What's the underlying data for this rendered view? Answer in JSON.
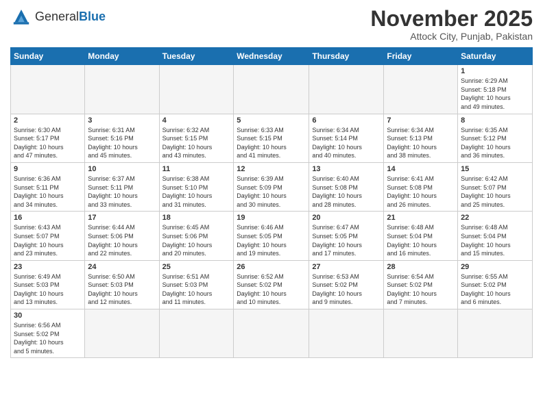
{
  "header": {
    "logo_general": "General",
    "logo_blue": "Blue",
    "month_title": "November 2025",
    "subtitle": "Attock City, Punjab, Pakistan"
  },
  "days_header": [
    "Sunday",
    "Monday",
    "Tuesday",
    "Wednesday",
    "Thursday",
    "Friday",
    "Saturday"
  ],
  "weeks": [
    [
      {
        "num": "",
        "info": ""
      },
      {
        "num": "",
        "info": ""
      },
      {
        "num": "",
        "info": ""
      },
      {
        "num": "",
        "info": ""
      },
      {
        "num": "",
        "info": ""
      },
      {
        "num": "",
        "info": ""
      },
      {
        "num": "1",
        "info": "Sunrise: 6:29 AM\nSunset: 5:18 PM\nDaylight: 10 hours\nand 49 minutes."
      }
    ],
    [
      {
        "num": "2",
        "info": "Sunrise: 6:30 AM\nSunset: 5:17 PM\nDaylight: 10 hours\nand 47 minutes."
      },
      {
        "num": "3",
        "info": "Sunrise: 6:31 AM\nSunset: 5:16 PM\nDaylight: 10 hours\nand 45 minutes."
      },
      {
        "num": "4",
        "info": "Sunrise: 6:32 AM\nSunset: 5:15 PM\nDaylight: 10 hours\nand 43 minutes."
      },
      {
        "num": "5",
        "info": "Sunrise: 6:33 AM\nSunset: 5:15 PM\nDaylight: 10 hours\nand 41 minutes."
      },
      {
        "num": "6",
        "info": "Sunrise: 6:34 AM\nSunset: 5:14 PM\nDaylight: 10 hours\nand 40 minutes."
      },
      {
        "num": "7",
        "info": "Sunrise: 6:34 AM\nSunset: 5:13 PM\nDaylight: 10 hours\nand 38 minutes."
      },
      {
        "num": "8",
        "info": "Sunrise: 6:35 AM\nSunset: 5:12 PM\nDaylight: 10 hours\nand 36 minutes."
      }
    ],
    [
      {
        "num": "9",
        "info": "Sunrise: 6:36 AM\nSunset: 5:11 PM\nDaylight: 10 hours\nand 34 minutes."
      },
      {
        "num": "10",
        "info": "Sunrise: 6:37 AM\nSunset: 5:11 PM\nDaylight: 10 hours\nand 33 minutes."
      },
      {
        "num": "11",
        "info": "Sunrise: 6:38 AM\nSunset: 5:10 PM\nDaylight: 10 hours\nand 31 minutes."
      },
      {
        "num": "12",
        "info": "Sunrise: 6:39 AM\nSunset: 5:09 PM\nDaylight: 10 hours\nand 30 minutes."
      },
      {
        "num": "13",
        "info": "Sunrise: 6:40 AM\nSunset: 5:08 PM\nDaylight: 10 hours\nand 28 minutes."
      },
      {
        "num": "14",
        "info": "Sunrise: 6:41 AM\nSunset: 5:08 PM\nDaylight: 10 hours\nand 26 minutes."
      },
      {
        "num": "15",
        "info": "Sunrise: 6:42 AM\nSunset: 5:07 PM\nDaylight: 10 hours\nand 25 minutes."
      }
    ],
    [
      {
        "num": "16",
        "info": "Sunrise: 6:43 AM\nSunset: 5:07 PM\nDaylight: 10 hours\nand 23 minutes."
      },
      {
        "num": "17",
        "info": "Sunrise: 6:44 AM\nSunset: 5:06 PM\nDaylight: 10 hours\nand 22 minutes."
      },
      {
        "num": "18",
        "info": "Sunrise: 6:45 AM\nSunset: 5:06 PM\nDaylight: 10 hours\nand 20 minutes."
      },
      {
        "num": "19",
        "info": "Sunrise: 6:46 AM\nSunset: 5:05 PM\nDaylight: 10 hours\nand 19 minutes."
      },
      {
        "num": "20",
        "info": "Sunrise: 6:47 AM\nSunset: 5:05 PM\nDaylight: 10 hours\nand 17 minutes."
      },
      {
        "num": "21",
        "info": "Sunrise: 6:48 AM\nSunset: 5:04 PM\nDaylight: 10 hours\nand 16 minutes."
      },
      {
        "num": "22",
        "info": "Sunrise: 6:48 AM\nSunset: 5:04 PM\nDaylight: 10 hours\nand 15 minutes."
      }
    ],
    [
      {
        "num": "23",
        "info": "Sunrise: 6:49 AM\nSunset: 5:03 PM\nDaylight: 10 hours\nand 13 minutes."
      },
      {
        "num": "24",
        "info": "Sunrise: 6:50 AM\nSunset: 5:03 PM\nDaylight: 10 hours\nand 12 minutes."
      },
      {
        "num": "25",
        "info": "Sunrise: 6:51 AM\nSunset: 5:03 PM\nDaylight: 10 hours\nand 11 minutes."
      },
      {
        "num": "26",
        "info": "Sunrise: 6:52 AM\nSunset: 5:02 PM\nDaylight: 10 hours\nand 10 minutes."
      },
      {
        "num": "27",
        "info": "Sunrise: 6:53 AM\nSunset: 5:02 PM\nDaylight: 10 hours\nand 9 minutes."
      },
      {
        "num": "28",
        "info": "Sunrise: 6:54 AM\nSunset: 5:02 PM\nDaylight: 10 hours\nand 7 minutes."
      },
      {
        "num": "29",
        "info": "Sunrise: 6:55 AM\nSunset: 5:02 PM\nDaylight: 10 hours\nand 6 minutes."
      }
    ],
    [
      {
        "num": "30",
        "info": "Sunrise: 6:56 AM\nSunset: 5:02 PM\nDaylight: 10 hours\nand 5 minutes."
      },
      {
        "num": "",
        "info": ""
      },
      {
        "num": "",
        "info": ""
      },
      {
        "num": "",
        "info": ""
      },
      {
        "num": "",
        "info": ""
      },
      {
        "num": "",
        "info": ""
      },
      {
        "num": "",
        "info": ""
      }
    ]
  ]
}
